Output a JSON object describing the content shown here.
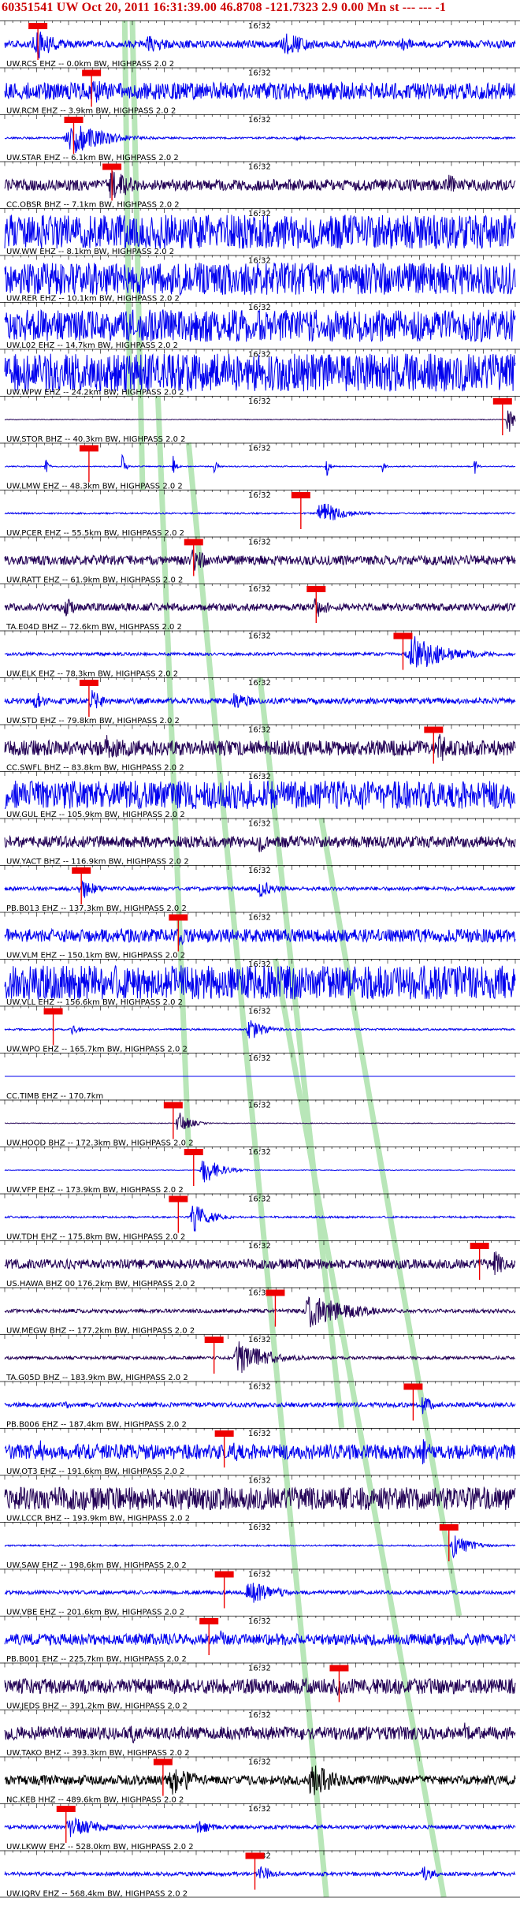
{
  "header": {
    "event_id": "60351541",
    "network": "UW",
    "datetime": "Oct 20, 2011 16:31:39.00",
    "location": "46.8708 -121.7323",
    "magnitude": "2.9 0.00 Mn st --- --- -1",
    "full_text": "60351541 UW Oct 20, 2011 16:31:39.00   46.8708 -121.7323  2.9 0.00 Mn st --- --- -1"
  },
  "time_label": "16:32",
  "colors": {
    "blue": "#0000ee",
    "navy": "#220055",
    "black": "#000000",
    "pick": "#ee0000",
    "band": "#b8e6b8",
    "header_text": "#cc0000"
  },
  "chart_data": {
    "type": "line",
    "title": "60351541 UW Oct 20, 2011 16:31:39.00   46.8708 -121.7323  2.9 0.00 Mn st --- --- -1",
    "x_units": "time",
    "traces": [
      {
        "name": "UW.RCS EHZ -- 0.0km BW, HIGHPASS 2.0 2",
        "color": "blue",
        "noise": 0.2,
        "events": [
          [
            0.06,
            0.9,
            0.04
          ],
          [
            0.28,
            0.5,
            0.05
          ],
          [
            0.55,
            0.7,
            0.05
          ],
          [
            0.78,
            0.4,
            0.03
          ]
        ],
        "pick": 0.065
      },
      {
        "name": "UW.RCM EHZ -- 3.9km BW, HIGHPASS 2.0 2",
        "color": "blue",
        "noise": 0.45,
        "events": [
          [
            0.17,
            0.8,
            0.04
          ]
        ],
        "pick": 0.17
      },
      {
        "name": "UW.STAR EHZ -- 6.1km BW, HIGHPASS 2.0 2",
        "color": "blue",
        "noise": 0.05,
        "events": [
          [
            0.13,
            1.0,
            0.06
          ],
          [
            0.57,
            0.15,
            0.02
          ]
        ],
        "pick": 0.135
      },
      {
        "name": "CC.OBSR BHZ -- 7.1km BW, HIGHPASS 2.0 2",
        "color": "navy",
        "noise": 0.3,
        "events": [
          [
            0.21,
            0.9,
            0.05
          ],
          [
            0.87,
            0.6,
            0.03
          ]
        ],
        "pick": 0.21
      },
      {
        "name": "UW.WW EHZ -- 8.1km BW, HIGHPASS 2.0 2",
        "color": "blue",
        "noise": 0.9,
        "events": [],
        "pick": null
      },
      {
        "name": "UW.RER EHZ -- 10.1km BW, HIGHPASS 2.0 2",
        "color": "blue",
        "noise": 0.85,
        "events": [],
        "pick": null
      },
      {
        "name": "UW.L02 EHZ -- 14.7km BW, HIGHPASS 2.0 2",
        "color": "blue",
        "noise": 0.85,
        "events": [],
        "pick": null
      },
      {
        "name": "UW.WPW EHZ -- 24.2km BW, HIGHPASS 2.0 2",
        "color": "blue",
        "noise": 1.0,
        "events": [],
        "pick": null
      },
      {
        "name": "UW.STOR BHZ -- 40.3km BW, HIGHPASS 2.0 2",
        "color": "navy",
        "noise": 0.02,
        "events": [
          [
            0.985,
            1.0,
            0.01
          ]
        ],
        "pick": 0.975
      },
      {
        "name": "UW.LMW EHZ -- 48.3km BW, HIGHPASS 2.0 2",
        "color": "blue",
        "noise": 0.03,
        "events": [
          [
            0.08,
            0.5,
            0.005
          ],
          [
            0.23,
            0.8,
            0.005
          ],
          [
            0.33,
            0.6,
            0.005
          ],
          [
            0.41,
            0.5,
            0.005
          ],
          [
            0.63,
            0.7,
            0.005
          ],
          [
            0.74,
            0.4,
            0.005
          ],
          [
            0.92,
            0.5,
            0.005
          ]
        ],
        "pick": 0.165
      },
      {
        "name": "UW.PCER EHZ -- 55.5km BW, HIGHPASS 2.0 2",
        "color": "blue",
        "noise": 0.04,
        "events": [
          [
            0.62,
            0.7,
            0.04
          ]
        ],
        "pick": 0.58
      },
      {
        "name": "UW.RATT EHZ -- 61.9km BW, HIGHPASS 2.0 2",
        "color": "navy",
        "noise": 0.25,
        "events": [
          [
            0.37,
            0.7,
            0.03
          ]
        ],
        "pick": 0.37
      },
      {
        "name": "TA.E04D BHZ -- 72.6km BW, HIGHPASS 2.0 2",
        "color": "navy",
        "noise": 0.2,
        "events": [
          [
            0.12,
            0.5,
            0.03
          ],
          [
            0.61,
            0.6,
            0.03
          ]
        ],
        "pick": 0.61
      },
      {
        "name": "UW.ELK EHZ -- 78.3km BW, HIGHPASS 2.0 2",
        "color": "blue",
        "noise": 0.08,
        "events": [
          [
            0.8,
            1.0,
            0.07
          ]
        ],
        "pick": 0.78
      },
      {
        "name": "UW.STD EHZ -- 79.8km BW, HIGHPASS 2.0 2",
        "color": "blue",
        "noise": 0.15,
        "events": [
          [
            0.06,
            0.6,
            0.02
          ],
          [
            0.17,
            0.6,
            0.03
          ],
          [
            0.45,
            0.5,
            0.04
          ]
        ],
        "pick": 0.165
      },
      {
        "name": "CC.SWFL BHZ -- 83.8km BW, HIGHPASS 2.0 2",
        "color": "navy",
        "noise": 0.4,
        "events": [
          [
            0.2,
            0.7,
            0.1
          ],
          [
            0.85,
            0.9,
            0.03
          ]
        ],
        "pick": 0.84
      },
      {
        "name": "UW.GUL EHZ -- 105.9km BW, HIGHPASS 2.0 2",
        "color": "blue",
        "noise": 0.75,
        "events": [],
        "pick": null
      },
      {
        "name": "UW.YACT BHZ -- 116.9km BW, HIGHPASS 2.0 2",
        "color": "navy",
        "noise": 0.3,
        "events": [
          [
            0.5,
            0.6,
            0.03
          ]
        ],
        "pick": null
      },
      {
        "name": "PB.B013 EHZ -- 137.3km BW, HIGHPASS 2.0 2",
        "color": "blue",
        "noise": 0.1,
        "events": [
          [
            0.15,
            0.6,
            0.03
          ],
          [
            0.5,
            0.5,
            0.03
          ]
        ],
        "pick": 0.15
      },
      {
        "name": "UW.VLM EHZ -- 150.1km BW, HIGHPASS 2.0 2",
        "color": "blue",
        "noise": 0.35,
        "events": [
          [
            0.34,
            0.7,
            0.03
          ]
        ],
        "pick": 0.34
      },
      {
        "name": "UW.VLL EHZ -- 156.6km BW, HIGHPASS 2.0 2",
        "color": "blue",
        "noise": 0.9,
        "events": [],
        "pick": null
      },
      {
        "name": "UW.WPO EHZ -- 165.7km BW, HIGHPASS 2.0 2",
        "color": "blue",
        "noise": 0.05,
        "events": [
          [
            0.13,
            0.3,
            0.02
          ],
          [
            0.48,
            0.6,
            0.03
          ]
        ],
        "pick": 0.095
      },
      {
        "name": "CC.TIMB EHZ -- 170.7km",
        "color": "blue",
        "noise": 0.0,
        "events": [],
        "pick": null
      },
      {
        "name": "UW.HOOD BHZ -- 172.3km BW, HIGHPASS 2.0 2",
        "color": "navy",
        "noise": 0.02,
        "events": [
          [
            0.34,
            0.7,
            0.02
          ]
        ],
        "pick": 0.33
      },
      {
        "name": "UW.VFP EHZ -- 173.9km BW, HIGHPASS 2.0 2",
        "color": "blue",
        "noise": 0.02,
        "events": [
          [
            0.39,
            0.8,
            0.03
          ]
        ],
        "pick": 0.37
      },
      {
        "name": "UW.TDH EHZ -- 175.8km BW, HIGHPASS 2.0 2",
        "color": "blue",
        "noise": 0.05,
        "events": [
          [
            0.37,
            0.9,
            0.03
          ]
        ],
        "pick": 0.34
      },
      {
        "name": "US.HAWA BHZ 00 176.2km BW, HIGHPASS 2.0 2",
        "color": "navy",
        "noise": 0.25,
        "events": [
          [
            0.96,
            0.8,
            0.02
          ]
        ],
        "pick": 0.93
      },
      {
        "name": "UW.MEGW BHZ -- 177.2km BW, HIGHPASS 2.0 2",
        "color": "navy",
        "noise": 0.1,
        "events": [
          [
            0.6,
            0.9,
            0.08
          ]
        ],
        "pick": 0.53
      },
      {
        "name": "TA.G05D BHZ -- 183.9km BW, HIGHPASS 2.0 2",
        "color": "navy",
        "noise": 0.08,
        "events": [
          [
            0.46,
            0.9,
            0.06
          ]
        ],
        "pick": 0.41
      },
      {
        "name": "PB.B006 EHZ -- 187.4km BW, HIGHPASS 2.0 2",
        "color": "blue",
        "noise": 0.12,
        "events": [
          [
            0.12,
            0.3,
            0.01
          ],
          [
            0.82,
            0.6,
            0.02
          ]
        ],
        "pick": 0.8
      },
      {
        "name": "UW.OT3 EHZ -- 191.6km BW, HIGHPASS 2.0 2",
        "color": "blue",
        "noise": 0.4,
        "events": [
          [
            0.07,
            0.7,
            0.02
          ],
          [
            0.45,
            0.7,
            0.03
          ],
          [
            0.82,
            0.8,
            0.02
          ]
        ],
        "pick": 0.43
      },
      {
        "name": "UW.LCCR BHZ -- 193.9km BW, HIGHPASS 2.0 2",
        "color": "navy",
        "noise": 0.6,
        "events": [],
        "pick": null
      },
      {
        "name": "UW.SAW EHZ -- 198.6km BW, HIGHPASS 2.0 2",
        "color": "blue",
        "noise": 0.04,
        "events": [
          [
            0.88,
            0.7,
            0.03
          ]
        ],
        "pick": 0.87
      },
      {
        "name": "UW.VBE EHZ -- 201.6km BW, HIGHPASS 2.0 2",
        "color": "blue",
        "noise": 0.1,
        "events": [
          [
            0.48,
            0.7,
            0.05
          ]
        ],
        "pick": 0.43
      },
      {
        "name": "PB.B001 EHZ -- 225.7km BW, HIGHPASS 2.0 2",
        "color": "blue",
        "noise": 0.3,
        "events": [
          [
            0.42,
            0.6,
            0.02
          ]
        ],
        "pick": 0.4
      },
      {
        "name": "UW.JEDS BHZ -- 391.2km BW, HIGHPASS 2.0 2",
        "color": "navy",
        "noise": 0.4,
        "events": [
          [
            0.65,
            0.6,
            0.03
          ]
        ],
        "pick": 0.655
      },
      {
        "name": "UW.TAKO BHZ -- 393.3km BW, HIGHPASS 2.0 2",
        "color": "navy",
        "noise": 0.35,
        "events": [
          [
            0.25,
            0.6,
            0.02
          ],
          [
            0.9,
            0.6,
            0.02
          ]
        ],
        "pick": null
      },
      {
        "name": "NC.KEB HHZ -- 489.6km BW, HIGHPASS 2.0 2",
        "color": "black",
        "noise": 0.25,
        "events": [
          [
            0.33,
            0.9,
            0.05
          ],
          [
            0.6,
            1.0,
            0.05
          ]
        ],
        "pick": 0.31
      },
      {
        "name": "UW.LKWW EHZ -- 528.0km BW, HIGHPASS 2.0 2",
        "color": "blue",
        "noise": 0.1,
        "events": [
          [
            0.13,
            0.6,
            0.06
          ],
          [
            0.38,
            0.4,
            0.03
          ]
        ],
        "pick": 0.12
      },
      {
        "name": "UW.IQRV EHZ -- 568.4km BW, HIGHPASS 2.0 2",
        "color": "blue",
        "noise": 0.1,
        "events": [
          [
            0.5,
            0.5,
            0.03
          ],
          [
            0.82,
            0.5,
            0.02
          ]
        ],
        "pick": 0.49
      }
    ],
    "bands": [
      {
        "start": [
          0.235,
          0
        ],
        "end": [
          0.245,
          8
        ]
      },
      {
        "start": [
          0.25,
          0
        ],
        "end": [
          0.27,
          10
        ]
      },
      {
        "start": [
          0.3,
          8
        ],
        "end": [
          0.36,
          24
        ]
      },
      {
        "start": [
          0.36,
          9
        ],
        "end": [
          0.63,
          40
        ]
      },
      {
        "start": [
          0.5,
          14
        ],
        "end": [
          0.66,
          30
        ]
      },
      {
        "start": [
          0.53,
          20
        ],
        "end": [
          0.86,
          40
        ]
      },
      {
        "start": [
          0.62,
          17
        ],
        "end": [
          0.89,
          34
        ]
      }
    ]
  }
}
